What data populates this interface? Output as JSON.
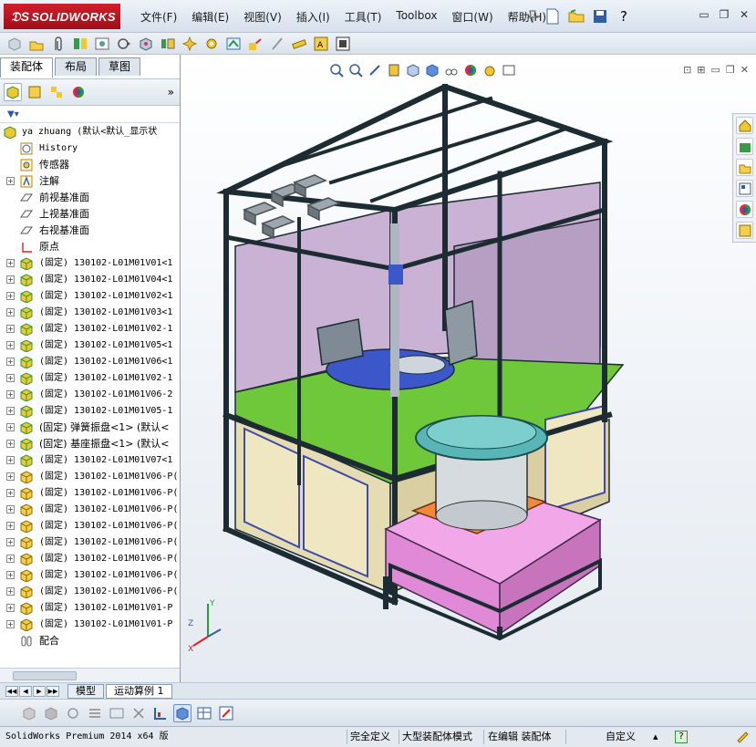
{
  "app": {
    "logo_text": "SOLIDWORKS",
    "menu": [
      "文件(F)",
      "编辑(E)",
      "视图(V)",
      "插入(I)",
      "工具(T)",
      "Toolbox",
      "窗口(W)",
      "帮助(H)"
    ],
    "help_label": "?"
  },
  "panel": {
    "tabs": [
      "装配体",
      "布局",
      "草图"
    ],
    "chevron": "»"
  },
  "tree": {
    "root": "ya zhuang  (默认<默认_显示状",
    "items": [
      {
        "label": "History",
        "icon": "history-icon",
        "mono": true
      },
      {
        "label": "传感器",
        "icon": "sensor-icon"
      },
      {
        "label": "注解",
        "icon": "annotation-icon",
        "expand": true
      },
      {
        "label": "前视基准面",
        "icon": "plane-icon"
      },
      {
        "label": "上视基准面",
        "icon": "plane-icon"
      },
      {
        "label": "右视基准面",
        "icon": "plane-icon"
      },
      {
        "label": "原点",
        "icon": "origin-icon"
      },
      {
        "label": "(固定) 130102-L01M01V01<1",
        "icon": "subassembly-icon",
        "expand": true
      },
      {
        "label": "(固定) 130102-L01M01V04<1",
        "icon": "subassembly-icon",
        "expand": true
      },
      {
        "label": "(固定) 130102-L01M01V02<1",
        "icon": "subassembly-icon",
        "expand": true
      },
      {
        "label": "(固定) 130102-L01M01V03<1",
        "icon": "subassembly-icon",
        "expand": true
      },
      {
        "label": "(固定) 130102-L01M01V02-1",
        "icon": "subassembly-icon",
        "expand": true
      },
      {
        "label": "(固定) 130102-L01M01V05<1",
        "icon": "subassembly-icon",
        "expand": true
      },
      {
        "label": "(固定) 130102-L01M01V06<1",
        "icon": "subassembly-icon",
        "expand": true
      },
      {
        "label": "(固定) 130102-L01M01V02-1",
        "icon": "subassembly-icon",
        "expand": true
      },
      {
        "label": "(固定) 130102-L01M01V06-2",
        "icon": "subassembly-icon",
        "expand": true
      },
      {
        "label": "(固定) 130102-L01M01V05-1",
        "icon": "subassembly-icon",
        "expand": true
      },
      {
        "label": "(固定) 弹簧振盘<1> (默认<",
        "icon": "subassembly-icon",
        "expand": true
      },
      {
        "label": "(固定) 基座振盘<1> (默认<",
        "icon": "subassembly-icon",
        "expand": true
      },
      {
        "label": "(固定) 130102-L01M01V07<1",
        "icon": "subassembly-icon",
        "expand": true
      },
      {
        "label": "(固定) 130102-L01M01V06-P(",
        "icon": "part-icon",
        "expand": true
      },
      {
        "label": "(固定) 130102-L01M01V06-P(",
        "icon": "part-icon",
        "expand": true
      },
      {
        "label": "(固定) 130102-L01M01V06-P(",
        "icon": "part-icon",
        "expand": true
      },
      {
        "label": "(固定) 130102-L01M01V06-P(",
        "icon": "part-icon",
        "expand": true
      },
      {
        "label": "(固定) 130102-L01M01V06-P(",
        "icon": "part-icon",
        "expand": true
      },
      {
        "label": "(固定) 130102-L01M01V06-P(",
        "icon": "part-icon",
        "expand": true
      },
      {
        "label": "(固定) 130102-L01M01V06-P(",
        "icon": "part-icon",
        "expand": true
      },
      {
        "label": "(固定) 130102-L01M01V06-P(",
        "icon": "part-icon",
        "expand": true
      },
      {
        "label": "(固定) 130102-L01M01V01-P",
        "icon": "part-icon",
        "expand": true
      },
      {
        "label": "(固定) 130102-L01M01V01-P",
        "icon": "part-icon",
        "expand": true
      },
      {
        "label": "配合",
        "icon": "mates-icon"
      }
    ]
  },
  "bottom_tabs": [
    "模型",
    "运动算例 1"
  ],
  "status": {
    "product": "SolidWorks Premium 2014 x64 版",
    "fully_defined": "完全定义",
    "large_assembly": "大型装配体模式",
    "editing": "在编辑 装配体",
    "custom": "自定义",
    "caret": "▴",
    "help": "?"
  },
  "triad": {
    "x": "X",
    "y": "Y",
    "z": "Z"
  },
  "colors": {
    "frame": "#1d2c33",
    "frame_edge": "#3f8a8e",
    "panel_pink": "#c9b2d4",
    "base_green": "#6fc83a",
    "cabinet_beige": "#e6dcb4",
    "cabinet_trim": "#3e4aa6",
    "feeder_teal": "#58b7b6",
    "feeder_base_pink": "#f2a7e8",
    "feeder_plate_orange": "#f08a3a",
    "solidworks_red": "#c81d29"
  }
}
